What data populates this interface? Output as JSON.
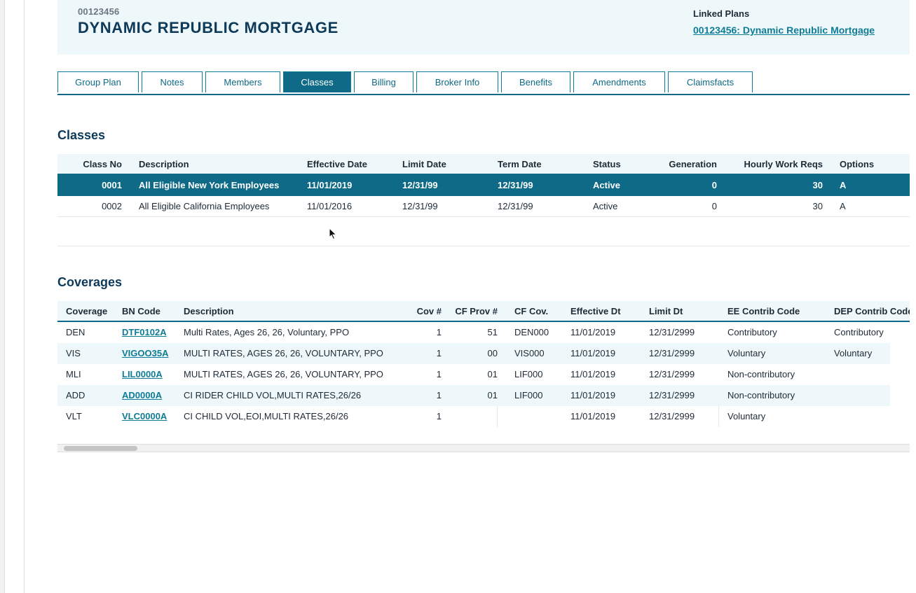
{
  "header": {
    "plan_id": "00123456",
    "plan_name": "DYNAMIC REPUBLIC MORTGAGE",
    "linked_plans_label": "Linked Plans",
    "linked_plan_link": "00123456: Dynamic Republic Mortgage"
  },
  "tabs": [
    {
      "label": "Group Plan"
    },
    {
      "label": "Notes"
    },
    {
      "label": "Members"
    },
    {
      "label": "Classes",
      "active": true
    },
    {
      "label": "Billing"
    },
    {
      "label": "Broker Info"
    },
    {
      "label": "Benefits"
    },
    {
      "label": "Amendments"
    },
    {
      "label": "Claimsfacts"
    }
  ],
  "classes": {
    "title": "Classes",
    "columns": [
      "Class No",
      "Description",
      "Effective Date",
      "Limit Date",
      "Term Date",
      "Status",
      "Generation",
      "Hourly Work Reqs",
      "Options"
    ],
    "rows": [
      {
        "class_no": "0001",
        "description": "All Eligible New York Employees",
        "effective_date": "11/01/2019",
        "limit_date": "12/31/99",
        "term_date": "12/31/99",
        "status": "Active",
        "generation": "0",
        "hourly_work_reqs": "30",
        "options": "A",
        "selected": true
      },
      {
        "class_no": "0002",
        "description": "All Eligible California Employees",
        "effective_date": "11/01/2016",
        "limit_date": "12/31/99",
        "term_date": "12/31/99",
        "status": "Active",
        "generation": "0",
        "hourly_work_reqs": "30",
        "options": "A",
        "selected": false
      }
    ]
  },
  "coverages": {
    "title": "Coverages",
    "columns": [
      "Coverage",
      "BN Code",
      "Description",
      "Cov #",
      "CF Prov #",
      "CF Cov.",
      "Effective Dt",
      "Limit Dt",
      "EE Contrib Code",
      "DEP Contrib Code"
    ],
    "rows": [
      {
        "coverage": "DEN",
        "bn_code": "DTF0102A",
        "description": "Multi Rates, Ages 26, 26, Voluntary, PPO",
        "cov_no": "1",
        "cf_prov_no": "51",
        "cf_cov": "DEN000",
        "effective_dt": "11/01/2019",
        "limit_dt": "12/31/2999",
        "ee_contrib": "Contributory",
        "dep_contrib": "Contributory"
      },
      {
        "coverage": "VIS",
        "bn_code": "VIGOO35A",
        "description": "MULTI RATES, AGES 26, 26, VOLUNTARY, PPO",
        "cov_no": "1",
        "cf_prov_no": "00",
        "cf_cov": "VIS000",
        "effective_dt": "11/01/2019",
        "limit_dt": "12/31/2999",
        "ee_contrib": "Voluntary",
        "dep_contrib": "Voluntary"
      },
      {
        "coverage": "MLI",
        "bn_code": "LIL0000A",
        "description": "MULTI RATES, AGES 26, 26, VOLUNTARY, PPO",
        "cov_no": "1",
        "cf_prov_no": "01",
        "cf_cov": "LIF000",
        "effective_dt": "11/01/2019",
        "limit_dt": "12/31/2999",
        "ee_contrib": "Non-contributory",
        "dep_contrib": ""
      },
      {
        "coverage": "ADD",
        "bn_code": "AD0000A",
        "description": "CI RIDER CHILD VOL,MULTI RATES,26/26",
        "cov_no": "1",
        "cf_prov_no": "01",
        "cf_cov": "LIF000",
        "effective_dt": "11/01/2019",
        "limit_dt": "12/31/2999",
        "ee_contrib": "Non-contributory",
        "dep_contrib": ""
      },
      {
        "coverage": "VLT",
        "bn_code": "VLC0000A",
        "description": "CI CHILD VOL,EOI,MULTI RATES,26/26",
        "cov_no": "1",
        "cf_prov_no": "",
        "cf_cov": "",
        "effective_dt": "11/01/2019",
        "limit_dt": "12/31/2999",
        "ee_contrib": "Voluntary",
        "dep_contrib": ""
      }
    ]
  },
  "colors": {
    "accent": "#0e6a86",
    "link": "#0e7c96",
    "title": "#0e3a5a",
    "panel": "#eef7f9"
  }
}
